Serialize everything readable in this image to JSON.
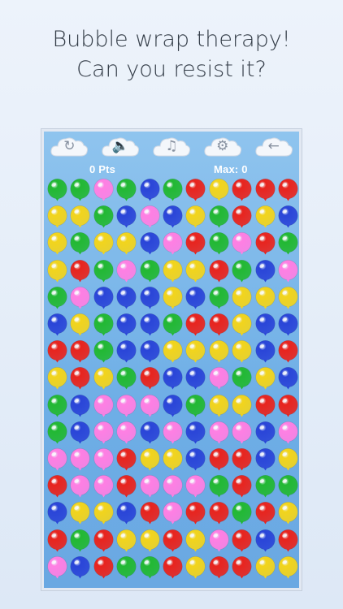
{
  "headline": {
    "line1": "Bubble wrap therapy!",
    "line2": "Can you resist it?"
  },
  "toolbar": {
    "buttons": [
      {
        "name": "restart",
        "icon": "restart-icon",
        "glyph": "↻"
      },
      {
        "name": "sound",
        "icon": "speaker-icon",
        "glyph": "🔈"
      },
      {
        "name": "music",
        "icon": "music-off-icon",
        "glyph": "♫"
      },
      {
        "name": "settings",
        "icon": "gear-icon",
        "glyph": "⚙"
      },
      {
        "name": "back",
        "icon": "back-arrow-icon",
        "glyph": "←"
      }
    ]
  },
  "score": {
    "points_label": "0 Pts",
    "max_label": "Max: 0"
  },
  "colors": {
    "G": "#22b833",
    "B": "#2a45d8",
    "P": "#ff7fe3",
    "R": "#e8241e",
    "Y": "#f2d41c"
  },
  "balloon_rows": [
    "GGPGBGRYRRR",
    "YYGBPBYGRYB",
    "YGYYBPRGPRG",
    "YRGPGYYRGBP",
    "GPBBBYBGYYY",
    "BYGBBGRRYBB",
    "RRGBBYYYYBR",
    "YRYGRBBPGYB",
    "GBPPPBGYYRR",
    "GBPPBPBPPBP",
    "PPPRYYBRRBY",
    "RPPRPPPGRGG",
    "BYYBRPRRGRY",
    "RGRYYRYPRBR",
    "PBRGGRYRRYY"
  ]
}
